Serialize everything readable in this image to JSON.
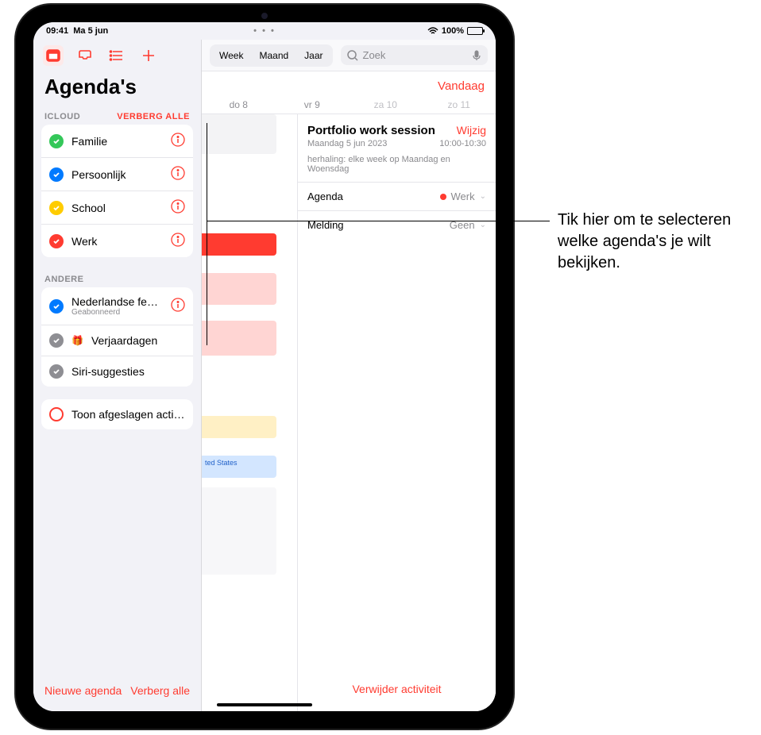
{
  "status": {
    "time": "09:41",
    "date": "Ma 5 jun",
    "battery": "100%"
  },
  "sidebar": {
    "title": "Agenda's",
    "section_icloud": {
      "label": "ICLOUD",
      "action": "VERBERG ALLE"
    },
    "icloud_items": [
      {
        "label": "Familie",
        "color": "green"
      },
      {
        "label": "Persoonlijk",
        "color": "blue"
      },
      {
        "label": "School",
        "color": "yellow"
      },
      {
        "label": "Werk",
        "color": "red"
      }
    ],
    "section_other": {
      "label": "ANDERE"
    },
    "other_items": [
      {
        "label": "Nederlandse feestdag…",
        "sub": "Geabonneerd",
        "color": "blue",
        "info": true
      },
      {
        "label": "Verjaardagen",
        "color": "grey",
        "gift": true
      },
      {
        "label": "Siri-suggesties",
        "color": "grey"
      }
    ],
    "declined": "Toon afgeslagen activiteiten",
    "footer": {
      "new": "Nieuwe agenda",
      "hide_all": "Verberg alle"
    }
  },
  "main": {
    "segments": {
      "week": "Week",
      "month": "Maand",
      "year": "Jaar"
    },
    "search_placeholder": "Zoek",
    "today": "Vandaag",
    "days": [
      "do 8",
      "vr 9",
      "za 10",
      "zo 11"
    ],
    "blue_strip": "ted States"
  },
  "event": {
    "title": "Portfolio work session",
    "edit": "Wijzig",
    "date": "Maandag 5 jun 2023",
    "time": "10:00-10:30",
    "repeat": "herhaling: elke week op Maandag en Woensdag",
    "agenda_label": "Agenda",
    "agenda_value": "Werk",
    "notif_label": "Melding",
    "notif_value": "Geen",
    "delete": "Verwijder activiteit"
  },
  "callout": "Tik hier om te selecteren welke agenda's je wilt bekijken."
}
